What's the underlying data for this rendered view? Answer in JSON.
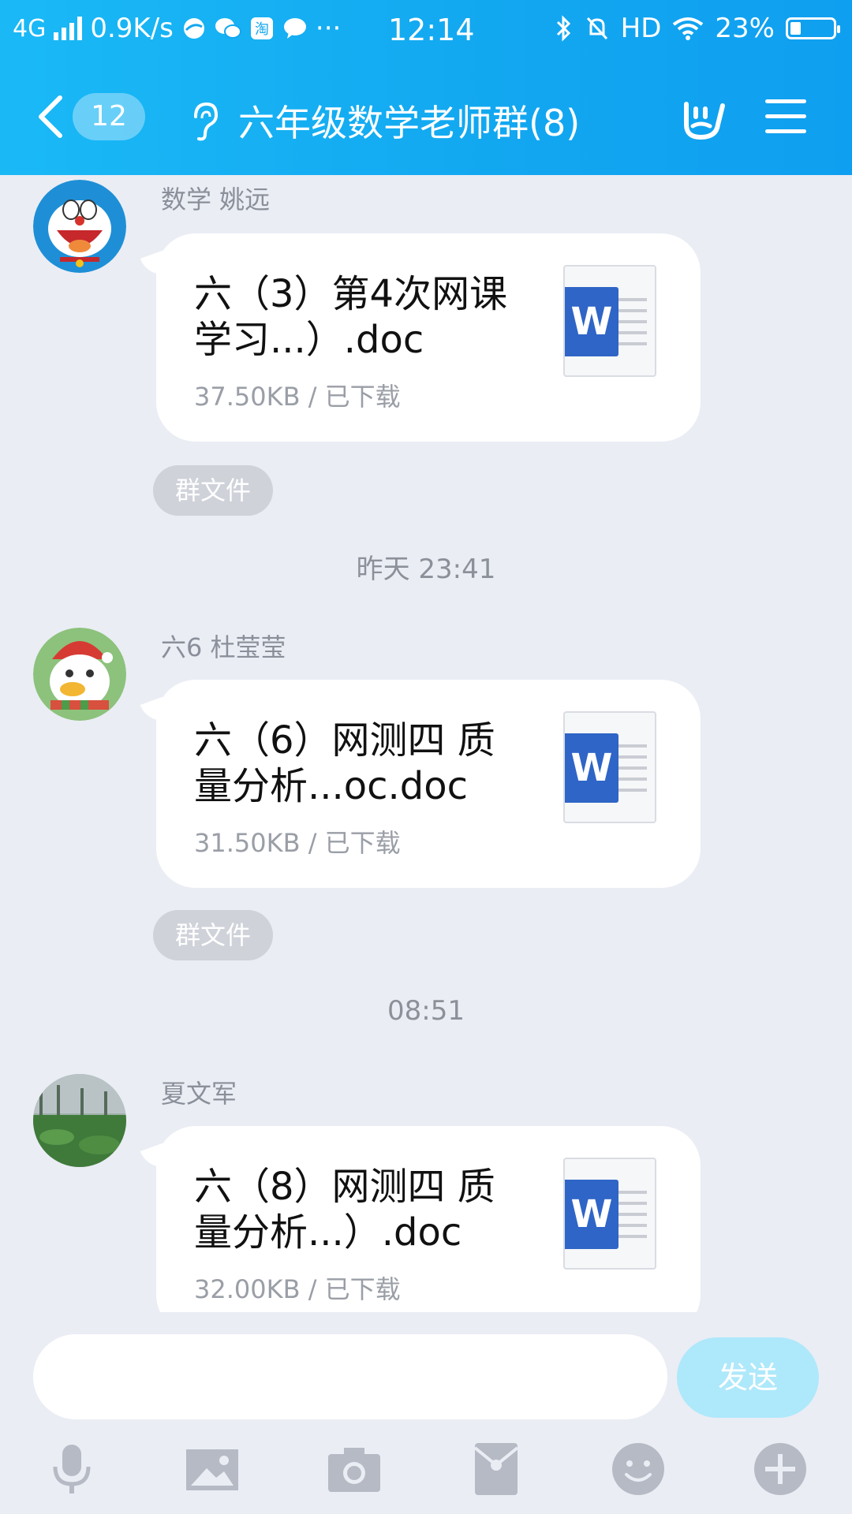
{
  "status_bar": {
    "network": "4G",
    "speed": "0.9K/s",
    "time": "12:14",
    "hd": "HD",
    "battery": "23%",
    "battery_level": 0.23
  },
  "header": {
    "unread_count": "12",
    "title": "六年级数学老师群(8)"
  },
  "messages": [
    {
      "sender": "数学  姚远",
      "file_name": "六（3）第4次网课学习...）.doc",
      "file_meta": "37.50KB / 已下载",
      "tag": "群文件"
    },
    {
      "time": "昨天 23:41",
      "sender": "六6 杜莹莹",
      "file_name": "六（6）网测四 质量分析...oc.doc",
      "file_meta": "31.50KB / 已下载",
      "tag": "群文件"
    },
    {
      "time": "08:51",
      "sender": "夏文军",
      "file_name": "六（8）网测四 质量分析...）.doc",
      "file_meta": "32.00KB / 已下载"
    }
  ],
  "doc_icon_letter": "W",
  "input": {
    "placeholder": "",
    "send_label": "发送"
  },
  "toolbar_icons": [
    "microphone-icon",
    "image-icon",
    "camera-icon",
    "red-packet-icon",
    "emoji-icon",
    "plus-icon"
  ],
  "colors": {
    "header_blue": "#12a7f0",
    "background": "#eaedf4",
    "send_button": "#aee8fb",
    "word_blue": "#2f65c6"
  }
}
